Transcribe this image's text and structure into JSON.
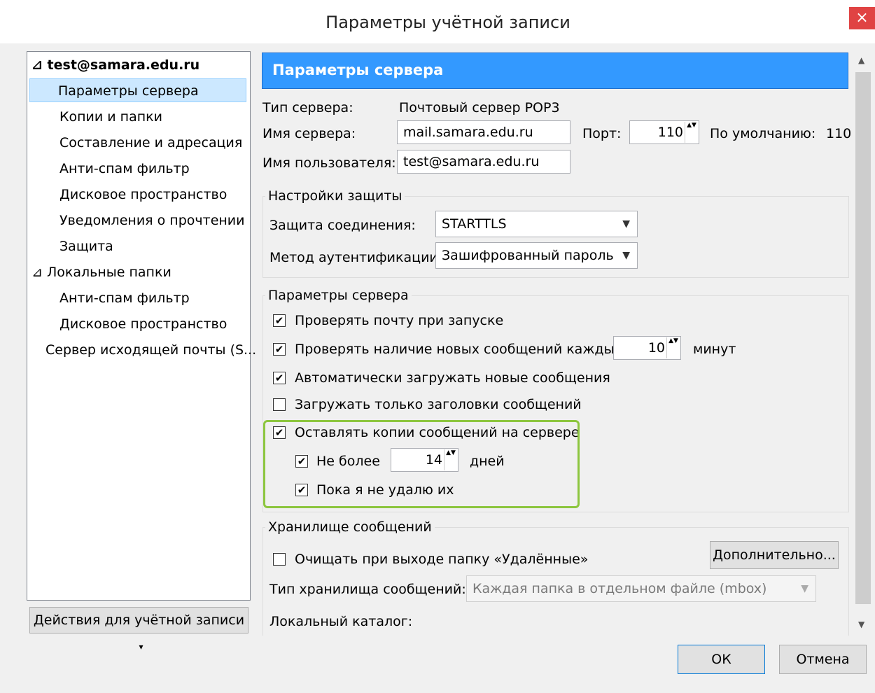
{
  "window": {
    "title": "Параметры учётной записи",
    "close_glyph": "×"
  },
  "tree": {
    "items": [
      {
        "label": "⊿ test@samara.edu.ru",
        "bold": true
      },
      {
        "label": "Параметры сервера",
        "selected": true
      },
      {
        "label": "Копии и папки"
      },
      {
        "label": "Составление и адресация"
      },
      {
        "label": "Анти-спам фильтр"
      },
      {
        "label": "Дисковое пространство"
      },
      {
        "label": "Уведомления о прочтении"
      },
      {
        "label": "Защита"
      },
      {
        "label": "⊿ Локальные папки"
      },
      {
        "label": "Анти-спам фильтр"
      },
      {
        "label": "Дисковое пространство"
      },
      {
        "label": "Сервер исходящей почты (S..."
      }
    ]
  },
  "account_actions": "Действия для учётной записи",
  "account_actions_arrow": "▾",
  "header": "Параметры сервера",
  "server": {
    "type_label": "Тип сервера:",
    "type_value": "Почтовый сервер POP3",
    "name_label": "Имя сервера:",
    "name_value": "mail.samara.edu.ru",
    "port_label": "Порт:",
    "port_value": "110",
    "default_label": "По умолчанию:",
    "default_value": "110",
    "user_label": "Имя пользователя:",
    "user_value": "test@samara.edu.ru"
  },
  "security": {
    "legend": "Настройки защиты",
    "conn_label": "Защита соединения:",
    "conn_value": "STARTTLS",
    "auth_label": "Метод аутентификации:",
    "auth_value": "Зашифрованный пароль"
  },
  "settings": {
    "legend": "Параметры сервера",
    "check_startup": "Проверять почту при запуске",
    "check_every": "Проверять наличие новых сообщений каждые",
    "check_every_value": "10",
    "minutes": "минут",
    "auto_download": "Автоматически загружать новые сообщения",
    "headers_only": "Загружать только заголовки сообщений",
    "leave_copies": "Оставлять копии сообщений на сервере",
    "no_more": "Не более",
    "no_more_value": "14",
    "days": "дней",
    "until_delete": "Пока я не удалю их"
  },
  "storage": {
    "legend": "Хранилище сообщений",
    "empty_trash": "Очищать при выходе папку «Удалённые»",
    "advanced": "Дополнительно...",
    "type_label": "Тип хранилища сообщений:",
    "type_value": "Каждая папка в отдельном файле (mbox)",
    "local_dir": "Локальный каталог:"
  },
  "buttons": {
    "ok": "ОК",
    "cancel": "Отмена"
  },
  "check_glyph": "✔",
  "spin_glyph": "▲▼",
  "colors": {
    "header_bg": "#3399ff",
    "highlight_border": "#8dc63f",
    "selection": "#cce8ff"
  }
}
